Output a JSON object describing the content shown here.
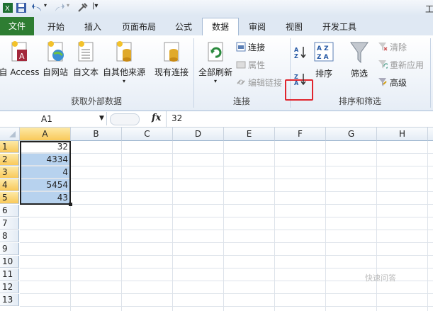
{
  "window": {
    "title_fragment": "工"
  },
  "qat": {
    "icons": [
      "excel-logo-icon",
      "save-icon",
      "undo-icon",
      "redo-icon",
      "customize-icon"
    ]
  },
  "tabs": [
    {
      "label": "文件"
    },
    {
      "label": "开始"
    },
    {
      "label": "插入"
    },
    {
      "label": "页面布局"
    },
    {
      "label": "公式"
    },
    {
      "label": "数据"
    },
    {
      "label": "审阅"
    },
    {
      "label": "视图"
    },
    {
      "label": "开发工具"
    }
  ],
  "ribbon": {
    "get_external": {
      "label": "获取外部数据",
      "buttons": [
        "自 Access",
        "自网站",
        "自文本",
        "自其他来源"
      ],
      "existing": "现有连接"
    },
    "connections": {
      "label": "连接",
      "refresh_all": "全部刷新",
      "connect": "连接",
      "properties": "属性",
      "edit_links": "编辑链接"
    },
    "sort_filter": {
      "label": "排序和筛选",
      "sort_az": "A↓Z",
      "sort_za": "Z↓A",
      "sort": "排序",
      "filter": "筛选",
      "clear": "清除",
      "reapply": "重新应用",
      "advanced": "高级"
    }
  },
  "formula_bar": {
    "name_box": "A1",
    "fx": "fx",
    "value": "32"
  },
  "grid": {
    "columns": [
      "A",
      "B",
      "C",
      "D",
      "E",
      "F",
      "G",
      "H"
    ],
    "rows": [
      "1",
      "2",
      "3",
      "4",
      "5",
      "6",
      "7",
      "8",
      "9",
      "10",
      "11",
      "12",
      "13"
    ],
    "colA": [
      "32",
      "4334",
      "4",
      "5454",
      "43"
    ]
  },
  "watermark": "快速问答",
  "colors": {
    "file_tab": "#2e7d32",
    "selection": "#b7d2ee",
    "highlight": "#e0262e"
  }
}
